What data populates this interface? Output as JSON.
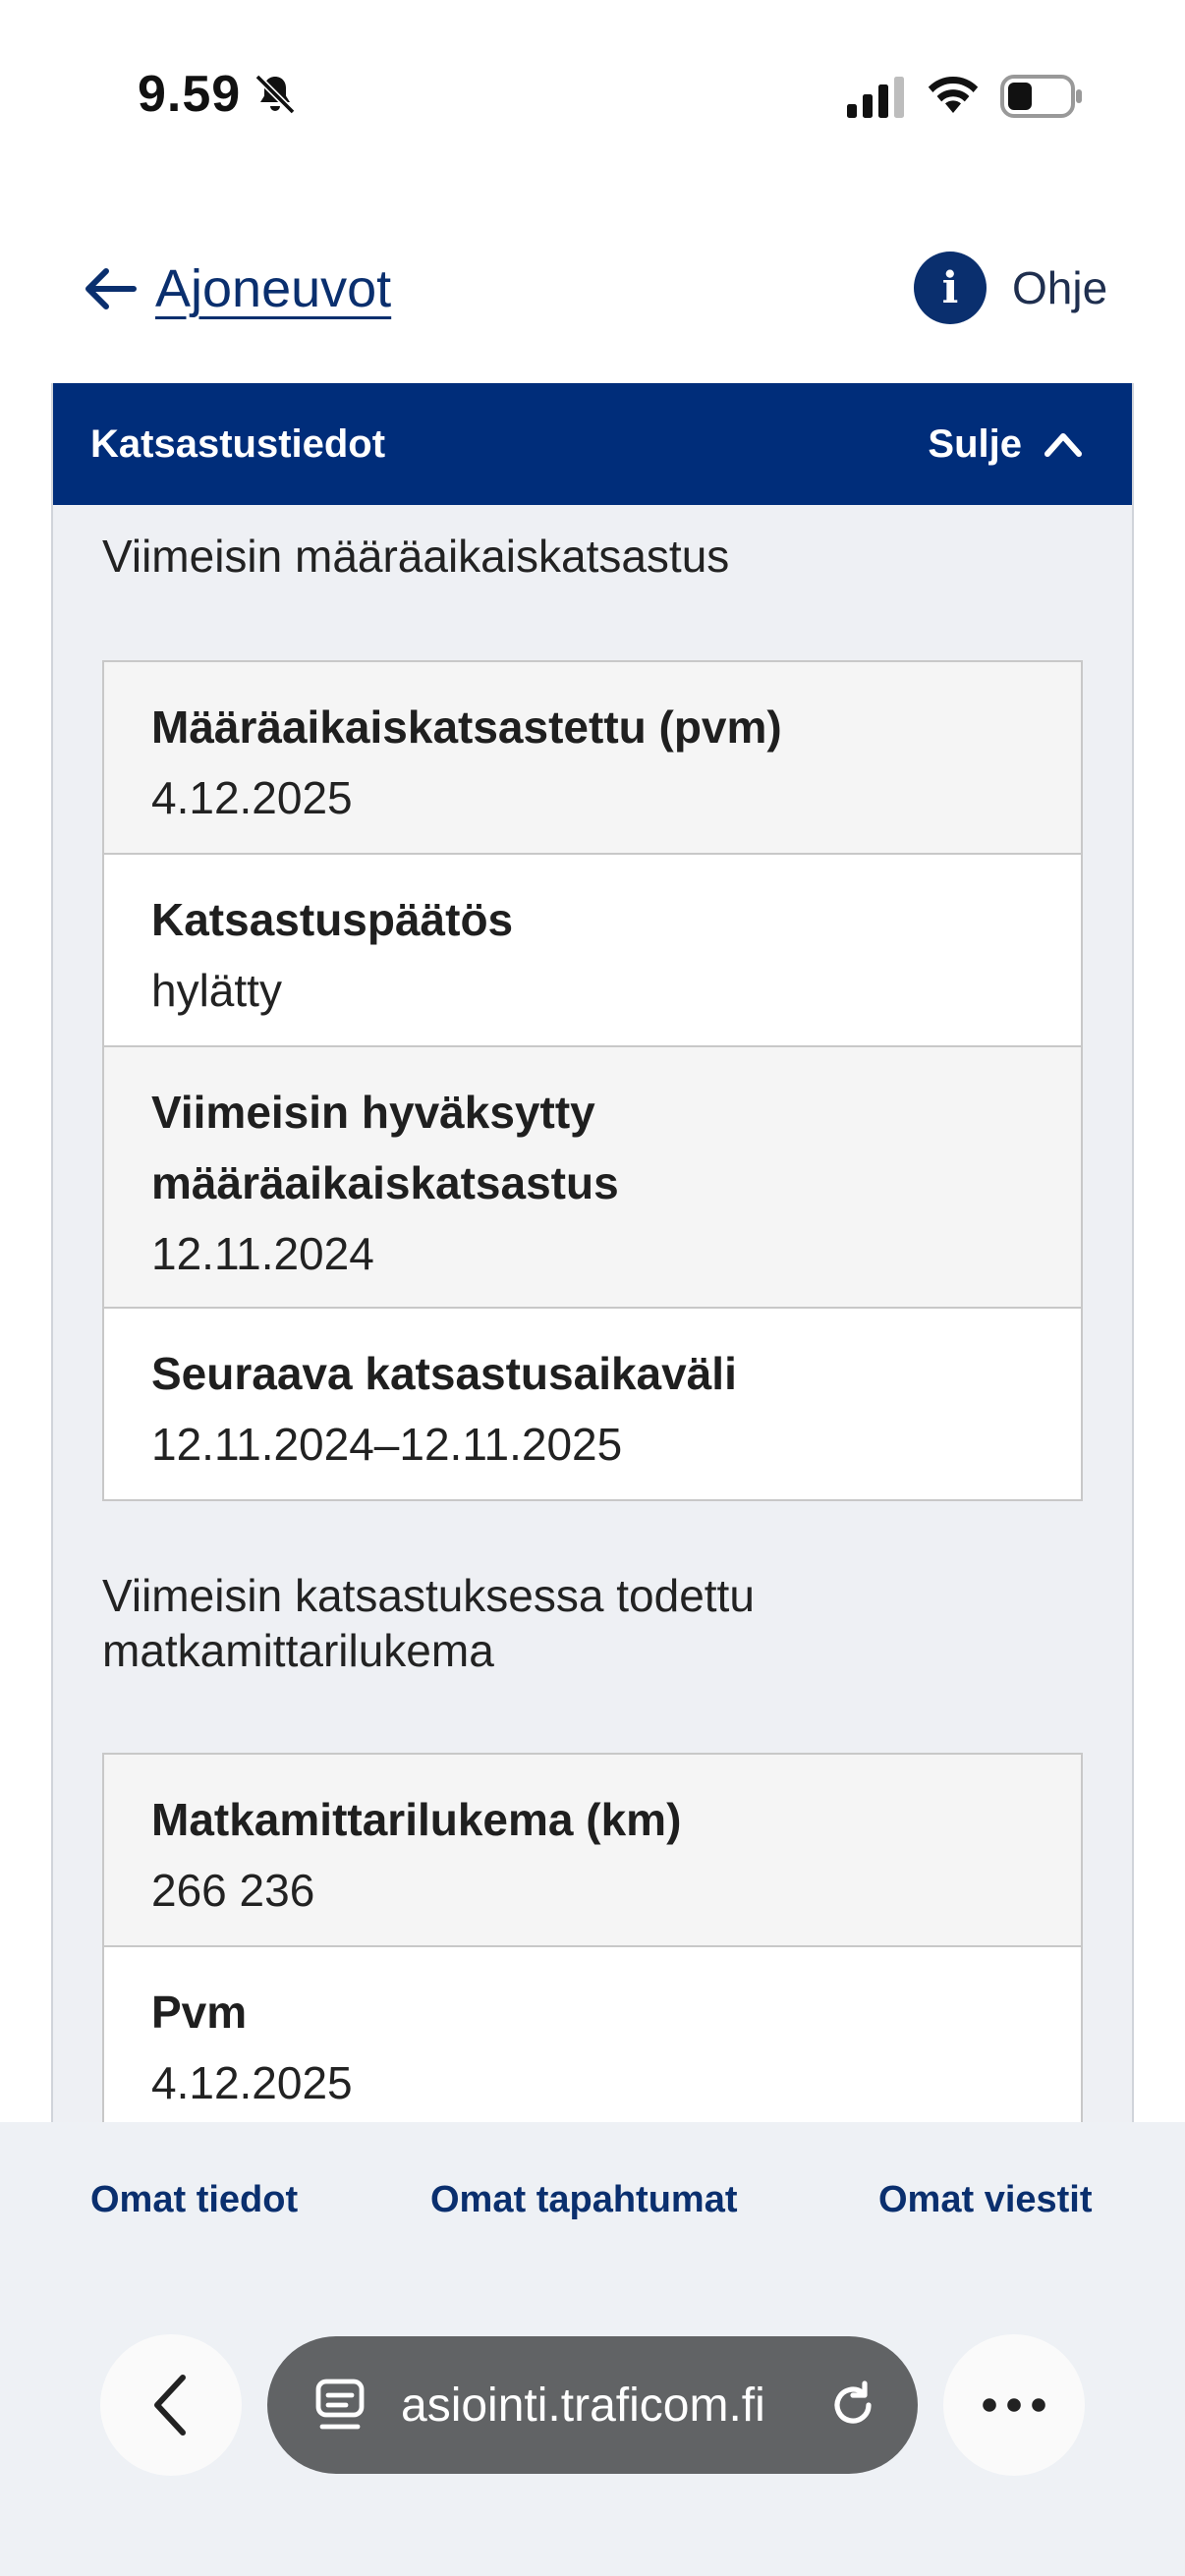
{
  "status_bar": {
    "time": "9.59"
  },
  "header": {
    "back_label": "Ajoneuvot",
    "help_label": "Ohje"
  },
  "panel": {
    "title": "Katsastustiedot",
    "close_label": "Sulje",
    "sections": [
      {
        "title": "Viimeisin määräaikaiskatsastus",
        "rows": [
          {
            "label": "Määräaikaiskatsastettu (pvm)",
            "value": "4.12.2025"
          },
          {
            "label": "Katsastuspäätös",
            "value": "hylätty"
          },
          {
            "label": "Viimeisin hyväksytty määräaikaiskatsastus",
            "value": "12.11.2024"
          },
          {
            "label": "Seuraava katsastusaikaväli",
            "value": "12.11.2024–12.11.2025"
          }
        ]
      },
      {
        "title": "Viimeisin katsastuksessa todettu matkamittarilukema",
        "rows": [
          {
            "label": "Matkamittarilukema (km)",
            "value": "266 236"
          },
          {
            "label": "Pvm",
            "value": "4.12.2025"
          }
        ]
      }
    ]
  },
  "bottom_nav": {
    "items": [
      "Omat tiedot",
      "Omat tapahtumat",
      "Omat viestit"
    ]
  },
  "browser": {
    "url": "asiointi.traficom.fi"
  },
  "icons": {
    "bell": "bell-muted-icon",
    "signal": "cellular-signal-icon",
    "wifi": "wifi-icon",
    "battery": "battery-icon",
    "back": "arrow-left-icon",
    "help": "info-icon",
    "collapse": "chevron-up-icon",
    "browser_back": "chevron-left-icon",
    "site": "site-settings-icon",
    "reload": "reload-icon",
    "more": "more-icon"
  },
  "colors": {
    "brand": "#002d7a",
    "link": "#0a2f6e",
    "panel_bg": "#eef0f4"
  }
}
